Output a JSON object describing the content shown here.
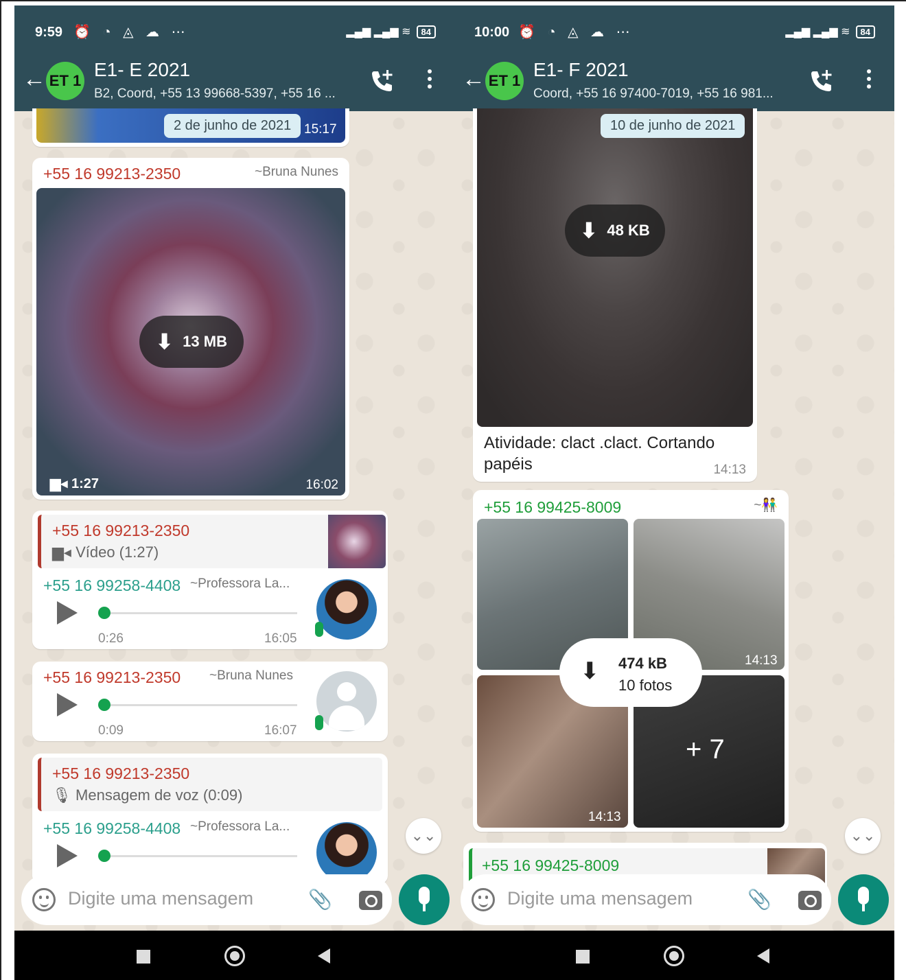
{
  "left": {
    "status": {
      "time": "9:59",
      "battery": "84"
    },
    "header": {
      "avatar": "ET 1",
      "title": "E1- E 2021",
      "subtitle": "B2, Coord, +55 13 99668-5397, +55 16 ..."
    },
    "date_chip": "2 de junho de 2021",
    "top_time": "15:17",
    "msg1": {
      "sender": "+55 16 99213-2350",
      "alias": "~Bruna Nunes",
      "size": "13 MB",
      "duration": "1:27",
      "time": "16:02"
    },
    "msg2": {
      "quote_sender": "+55 16 99213-2350",
      "quote_text": "Vídeo (1:27)",
      "sender": "+55 16 99258-4408",
      "alias": "~Professora La...",
      "elapsed": "0:26",
      "time": "16:05"
    },
    "msg3": {
      "sender": "+55 16 99213-2350",
      "alias": "~Bruna Nunes",
      "elapsed": "0:09",
      "time": "16:07"
    },
    "msg4": {
      "quote_sender": "+55 16 99213-2350",
      "quote_text": "Mensagem de voz (0:09)",
      "sender": "+55 16 99258-4408",
      "alias": "~Professora La..."
    },
    "input_placeholder": "Digite uma mensagem"
  },
  "right": {
    "status": {
      "time": "10:00",
      "battery": "84"
    },
    "header": {
      "avatar": "ET 1",
      "title": "E1- F 2021",
      "subtitle": "Coord, +55 16 97400-7019, +55 16 981..."
    },
    "date_chip": "10 de junho de 2021",
    "msg1": {
      "size": "48 KB",
      "caption": "Atividade: clact .clact. Cortando papéis",
      "time": "14:13"
    },
    "msg2": {
      "sender": "+55 16 99425-8009",
      "alias": "~",
      "size": "474 kB",
      "count": "10 fotos",
      "time_a": "14:13",
      "time_b": "14:13",
      "more": "+ 7"
    },
    "msg3": {
      "sender": "+55 16 99425-8009"
    },
    "input_placeholder": "Digite uma mensagem"
  },
  "icons": [
    "back-arrow-icon",
    "add-call-icon",
    "more-vert-icon",
    "download-icon",
    "video-icon",
    "play-icon",
    "mic-icon",
    "emoji-icon",
    "attach-icon",
    "camera-icon",
    "chevron-down-icon",
    "nav-recent-icon",
    "nav-home-icon",
    "nav-back-icon"
  ],
  "colors": {
    "header": "#2e4d58",
    "accent": "#0b8a78",
    "sender_red": "#c0392b",
    "sender_teal": "#2b9f8c",
    "sender_green": "#1f9e3a"
  }
}
